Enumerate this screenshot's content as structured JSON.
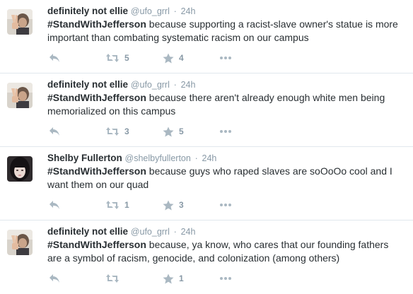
{
  "tweets": [
    {
      "display_name": "definitely not ellie",
      "handle": "@ufo_grrl",
      "separator": "·",
      "time": "24h",
      "hashtag": "#StandWithJefferson",
      "text": " because supporting a racist-slave owner's statue is more important than combating systematic racism on our campus",
      "retweets": "5",
      "favorites": "4",
      "avatar": "ellie"
    },
    {
      "display_name": "definitely not ellie",
      "handle": "@ufo_grrl",
      "separator": "·",
      "time": "24h",
      "hashtag": "#StandWithJefferson",
      "text": " because there aren't already enough white men being memorialized on this campus",
      "retweets": "3",
      "favorites": "5",
      "avatar": "ellie"
    },
    {
      "display_name": "Shelby Fullerton",
      "handle": "@shelbyfullerton",
      "separator": "·",
      "time": "24h",
      "hashtag": "#StandWithJefferson",
      "text": " because guys who raped slaves are soOoOo cool and I want them on our quad",
      "retweets": "1",
      "favorites": "3",
      "avatar": "shelby"
    },
    {
      "display_name": "definitely not ellie",
      "handle": "@ufo_grrl",
      "separator": "·",
      "time": "24h",
      "hashtag": "#StandWithJefferson",
      "text": " because, ya know, who cares that our founding fathers are a symbol of racism, genocide, and colonization (among others)",
      "retweets": "",
      "favorites": "1",
      "avatar": "ellie"
    }
  ],
  "colors": {
    "text": "#292f33",
    "secondary": "#8899a6",
    "icon": "#aab8c2",
    "divider": "#e1e8ed"
  },
  "icons": [
    "reply-icon",
    "retweet-icon",
    "favorite-star-icon",
    "more-dots-icon"
  ]
}
